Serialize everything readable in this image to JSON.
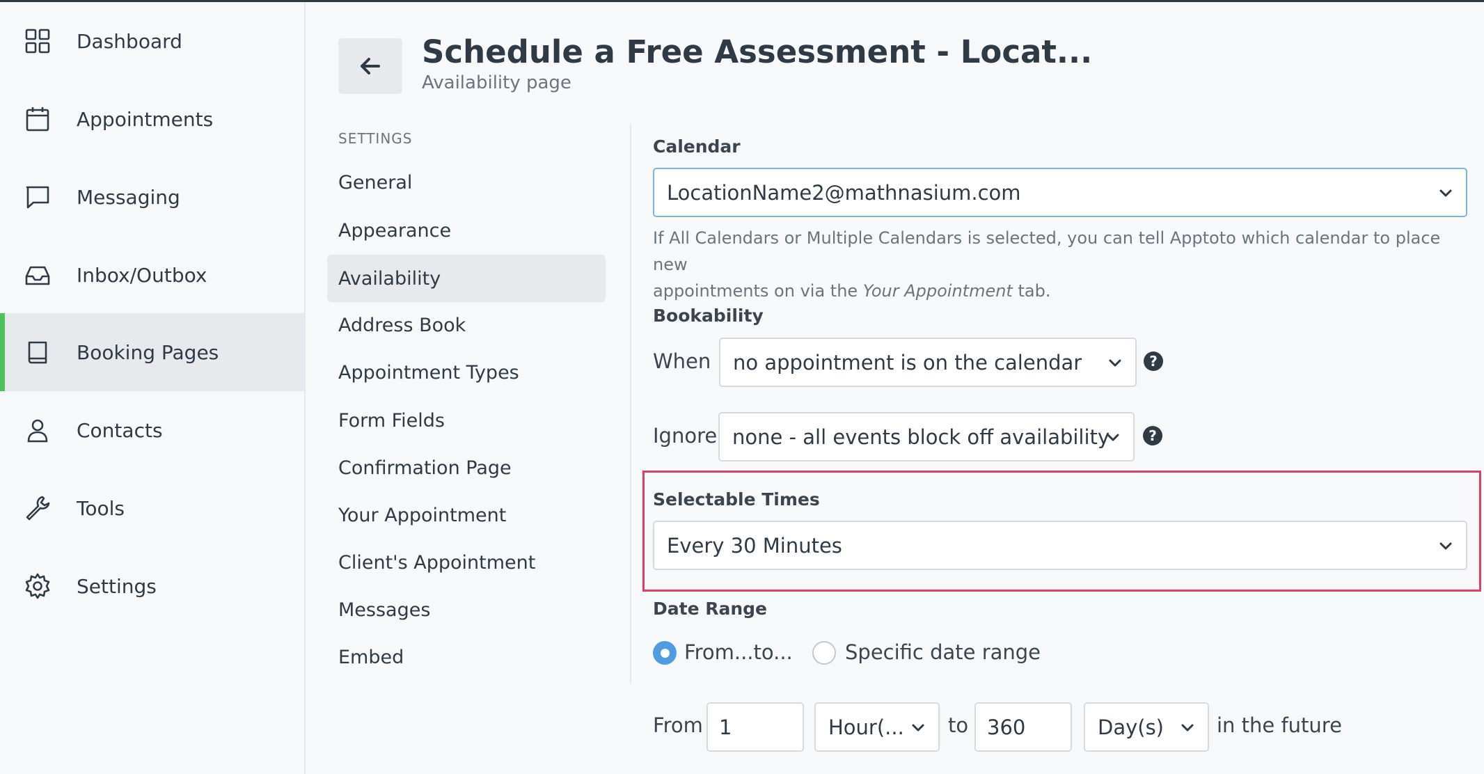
{
  "nav": {
    "items": [
      {
        "label": "Dashboard",
        "icon": "grid-icon"
      },
      {
        "label": "Appointments",
        "icon": "calendar-icon"
      },
      {
        "label": "Messaging",
        "icon": "chat-bubble-icon"
      },
      {
        "label": "Inbox/Outbox",
        "icon": "inbox-icon"
      },
      {
        "label": "Booking Pages",
        "icon": "book-icon",
        "active": true
      },
      {
        "label": "Contacts",
        "icon": "user-icon"
      },
      {
        "label": "Tools",
        "icon": "wrench-icon"
      },
      {
        "label": "Settings",
        "icon": "gear-icon"
      }
    ],
    "accent_color": "#4ec25a"
  },
  "header": {
    "title": "Schedule a Free Assessment - Locat...",
    "subtitle": "Availability page"
  },
  "settings_menu": {
    "heading": "SETTINGS",
    "items": [
      "General",
      "Appearance",
      "Availability",
      "Address Book",
      "Appointment Types",
      "Form Fields",
      "Confirmation Page",
      "Your Appointment",
      "Client's Appointment",
      "Messages",
      "Embed"
    ],
    "active": "Availability"
  },
  "form": {
    "calendar": {
      "label": "Calendar",
      "value": "LocationName2@mathnasium.com",
      "help_part1": "If All Calendars or Multiple Calendars is selected, you can tell Apptoto which calendar to place new",
      "help_part2": "appointments on via the ",
      "help_em": "Your Appointment",
      "help_part3": " tab."
    },
    "bookability": {
      "label": "Bookability",
      "when_label": "When",
      "when_value": "no appointment is on the calendar",
      "ignore_label": "Ignore",
      "ignore_value": "none - all events block off availability",
      "help_glyph": "?"
    },
    "selectable_times": {
      "label": "Selectable Times",
      "value": "Every 30 Minutes",
      "highlight_color": "#d9416b"
    },
    "date_range": {
      "label": "Date Range",
      "option1": "From...to...",
      "option2": "Specific date range",
      "selected": "From...to...",
      "from_label": "From",
      "from_value": "1",
      "from_unit": "Hour(...",
      "to_label": "to",
      "to_value": "360",
      "to_unit": "Day(s)",
      "suffix": "in the future"
    }
  }
}
